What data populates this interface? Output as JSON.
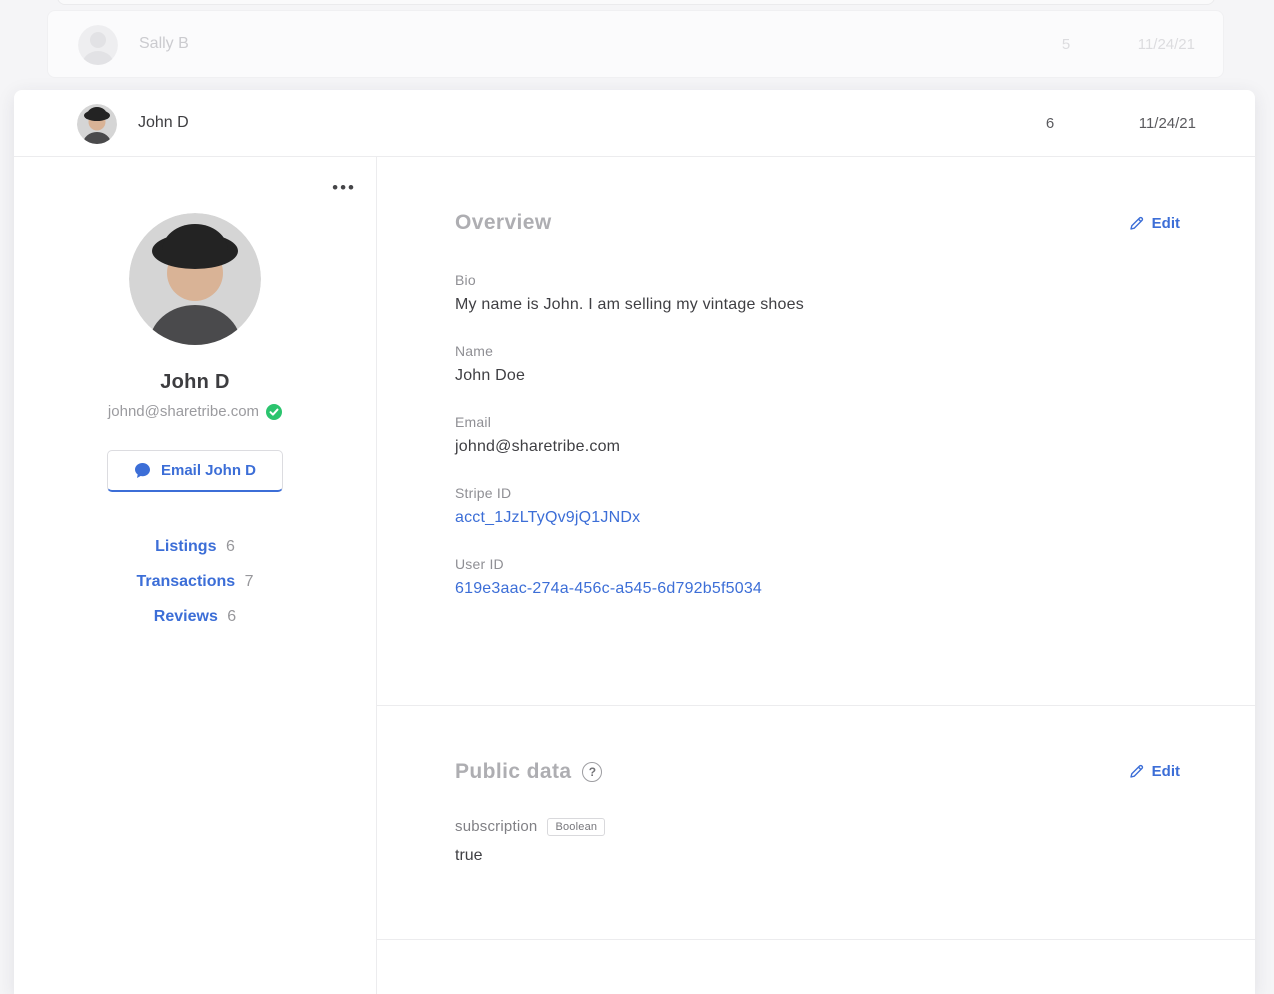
{
  "colors": {
    "accent_blue": "#3c6ed7",
    "verified_green": "#2bc46e",
    "page_bg": "#f5f5f7",
    "card_bg": "#ffffff"
  },
  "icons": {
    "ellipsis": "•••",
    "help": "?"
  },
  "rows": {
    "faded": {
      "name": "Sally B",
      "count": "5",
      "date": "11/24/21"
    },
    "active": {
      "name": "John D",
      "count": "6",
      "date": "11/24/21"
    }
  },
  "profile": {
    "name": "John D",
    "email": "johnd@sharetribe.com",
    "email_button_label": "Email John D",
    "links": [
      {
        "label": "Listings",
        "count": "6"
      },
      {
        "label": "Transactions",
        "count": "7"
      },
      {
        "label": "Reviews",
        "count": "6"
      }
    ]
  },
  "overview": {
    "title": "Overview",
    "edit_label": "Edit",
    "fields": [
      {
        "label": "Bio",
        "value": "My name is John. I am selling my vintage shoes"
      },
      {
        "label": "Name",
        "value": "John Doe"
      },
      {
        "label": "Email",
        "value": "johnd@sharetribe.com"
      },
      {
        "label": "Stripe ID",
        "value": "acct_1JzLTyQv9jQ1JNDx"
      },
      {
        "label": "User ID",
        "value": "619e3aac-274a-456c-a545-6d792b5f5034"
      }
    ]
  },
  "public_data": {
    "title": "Public data",
    "edit_label": "Edit",
    "entries": [
      {
        "key": "subscription",
        "type": "Boolean",
        "value": "true"
      }
    ]
  }
}
